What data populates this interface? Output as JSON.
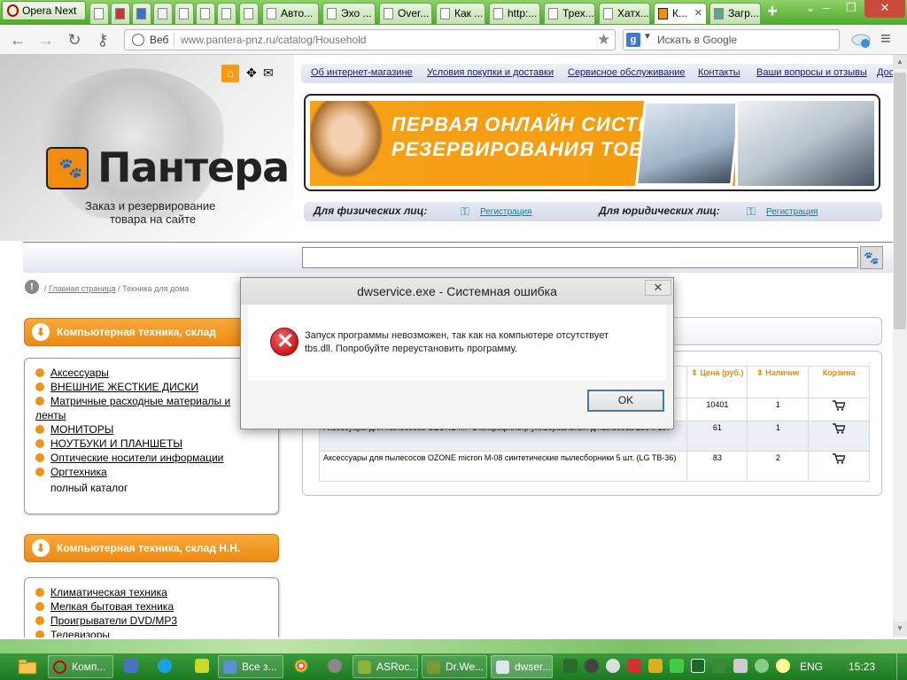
{
  "browser": {
    "menu_label": "Opera Next",
    "tabs": [
      {
        "label": ""
      },
      {
        "label": ""
      },
      {
        "label": ""
      },
      {
        "label": ""
      },
      {
        "label": ""
      },
      {
        "label": ""
      },
      {
        "label": "Авто..."
      },
      {
        "label": "Эхо ..."
      },
      {
        "label": "Over..."
      },
      {
        "label": "Как ..."
      },
      {
        "label": "http:..."
      },
      {
        "label": "Трех..."
      },
      {
        "label": "Хатх..."
      },
      {
        "label": "К..."
      },
      {
        "label": "Загр..."
      }
    ],
    "address": {
      "label": "Веб",
      "url": "www.pantera-pnz.ru/catalog/Household"
    },
    "search": {
      "placeholder": "Искать в Google",
      "engine_letter": "g"
    }
  },
  "site": {
    "logo_text": "Пантера",
    "tagline_1": "Заказ и резервирование",
    "tagline_2": "товара на сайте",
    "nav": [
      "Об интернет-магазине",
      "Условия покупки и доставки",
      "Сервисное обслуживание",
      "Контакты",
      "Ваши вопросы и отзывы",
      "Дос"
    ],
    "banner_title_1": "ПЕРВАЯ ОНЛАЙН СИСТЕ",
    "banner_title_2": "РЕЗЕРВИРОВАНИЯ ТОВАР",
    "reg": {
      "individuals": "Для физических лиц:",
      "companies": "Для юридических лиц:",
      "link": "Регистрация"
    },
    "breadcrumb": {
      "home": "Главная страница",
      "sep": "/",
      "current": "Техника для дома"
    },
    "categories_1": {
      "title": "Компьютерная техника, склад ",
      "items": [
        "Аксессуары",
        "ВНЕШНИЕ ЖЕСТКИЕ ДИСКИ",
        "Матричные расходные материалы и",
        "ленты",
        "МОНИТОРЫ",
        "НОУТБУКИ И ПЛАНШЕТЫ",
        "Оптические носители информации",
        "Оргтехника"
      ],
      "all": "полный каталог"
    },
    "categories_2": {
      "title": "Компьютерная техника, склад Н.Н.",
      "items": [
        "Климатическая техника",
        "Мелкая бытовая техника",
        "Проигрыватели DVD/MP3",
        "Телевизоры"
      ]
    },
    "table": {
      "headers": {
        "price": "Цена (руб.)",
        "stock": "Наличие",
        "cart": "Корзина"
      },
      "rows": [
        {
          "name": "",
          "price": "10401",
          "stock": "1"
        },
        {
          "name": "Аксессуары для пылесосов  OZONE MF-1 микрофильтр универсальный д/пылесоса 255 x 197",
          "price": "61",
          "stock": "1"
        },
        {
          "name": "Аксессуары для пылесосов  OZONE micron M-08 синтетические пылесборники 5 шт. (LG TB-36)",
          "price": "83",
          "stock": "2"
        }
      ]
    }
  },
  "dialog": {
    "title": "dwservice.exe - Системная ошибка",
    "close": "✕",
    "message_1": "Запуск программы невозможен, так как на компьютере отсутствует",
    "message_2": "tbs.dll. Попробуйте переустановить программу.",
    "ok": "OK"
  },
  "taskbar": {
    "apps": [
      {
        "label": "Комп..."
      },
      {
        "label": "Все з..."
      },
      {
        "label": "ASRoc..."
      },
      {
        "label": "Dr.We..."
      },
      {
        "label": "dwser..."
      }
    ],
    "lang": "ENG",
    "time": "15:23"
  },
  "colors": {
    "accent": "#f0921c",
    "taskbar": "#1d7b22",
    "tabbar": "#4fa82d"
  }
}
